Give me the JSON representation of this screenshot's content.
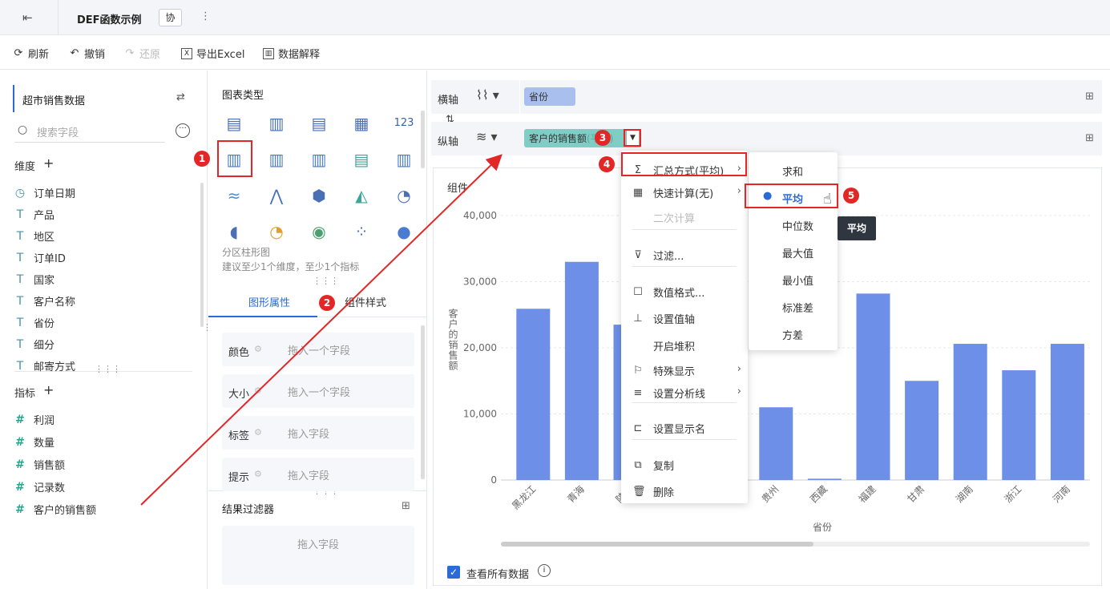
{
  "topbar": {
    "title": "DEF函数示例",
    "collab": "协",
    "more": "⋮"
  },
  "toolbar": {
    "refresh": "刷新",
    "undo": "撤销",
    "redo": "还原",
    "export": "导出Excel",
    "explain": "数据解释"
  },
  "left": {
    "dataset": "超市销售数据",
    "search_placeholder": "搜索字段",
    "dim_header": "维度",
    "measure_header": "指标",
    "dimensions": [
      "订单日期",
      "产品",
      "地区",
      "订单ID",
      "国家",
      "客户名称",
      "省份",
      "细分",
      "邮寄方式"
    ],
    "measures": [
      "利润",
      "数量",
      "销售额",
      "记录数",
      "客户的销售额"
    ]
  },
  "mid": {
    "chart_type_title": "图表类型",
    "chart_name": "分区柱形图",
    "chart_hint": "建议至少1个维度，至少1个指标",
    "tab_graph": "图形属性",
    "tab_style": "组件样式",
    "props": [
      {
        "label": "颜色",
        "placeholder": "拖入一个字段"
      },
      {
        "label": "大小",
        "placeholder": "拖入一个字段"
      },
      {
        "label": "标签",
        "placeholder": "拖入字段"
      },
      {
        "label": "提示",
        "placeholder": "拖入字段"
      }
    ],
    "filter_title": "结果过滤器",
    "filter_placeholder": "拖入字段"
  },
  "axes": {
    "x_label": "横轴",
    "x_field": "省份",
    "y_label": "纵轴",
    "y_field": "客户的销售额",
    "y_suffix": "(平均)"
  },
  "chart_panel": {
    "title": "组件",
    "view_all": "查看所有数据"
  },
  "menu": {
    "items": [
      {
        "label": "汇总方式(平均)",
        "icon": "Σ",
        "has_sub": true
      },
      {
        "label": "快速计算(无)",
        "icon": "▦",
        "has_sub": true
      },
      {
        "label": "二次计算",
        "icon": "",
        "disabled": true
      },
      {
        "label": "过滤...",
        "icon": "⊽"
      },
      {
        "label": "数值格式...",
        "icon": "☐"
      },
      {
        "label": "设置值轴",
        "icon": "⊥"
      },
      {
        "label": "开启堆积",
        "icon": ""
      },
      {
        "label": "特殊显示",
        "icon": "⚐",
        "has_sub": true
      },
      {
        "label": "设置分析线",
        "icon": "≡",
        "has_sub": true
      },
      {
        "label": "设置显示名",
        "icon": "⊏"
      },
      {
        "label": "复制",
        "icon": "⧉"
      },
      {
        "label": "删除",
        "icon": "🗑"
      }
    ]
  },
  "submenu": {
    "items": [
      "求和",
      "平均",
      "中位数",
      "最大值",
      "最小值",
      "标准差",
      "方差"
    ],
    "selected": "平均"
  },
  "tooltip": "平均",
  "badges": [
    "1",
    "2",
    "3",
    "4",
    "5"
  ],
  "colors": {
    "bar": "#6d8fe8",
    "accent": "#2c6bd6",
    "red": "#e32727",
    "pill_x": "#a9c0ee",
    "pill_y": "#7fcdc4"
  },
  "chart_data": {
    "type": "bar",
    "xlabel": "省份",
    "ylabel": "客户的销售额",
    "ylim": [
      0,
      40000
    ],
    "y_ticks": [
      "40,000",
      "30,000",
      "20,000",
      "10,000",
      "0"
    ],
    "categories": [
      "黑龙江",
      "青海",
      "陕西",
      "",
      "",
      "贵州",
      "西藏",
      "福建",
      "甘肃",
      "湖南",
      "浙江",
      "河南"
    ],
    "values": [
      25900,
      33000,
      23500,
      0,
      0,
      11000,
      200,
      28200,
      15000,
      20600,
      16600,
      20600
    ]
  }
}
